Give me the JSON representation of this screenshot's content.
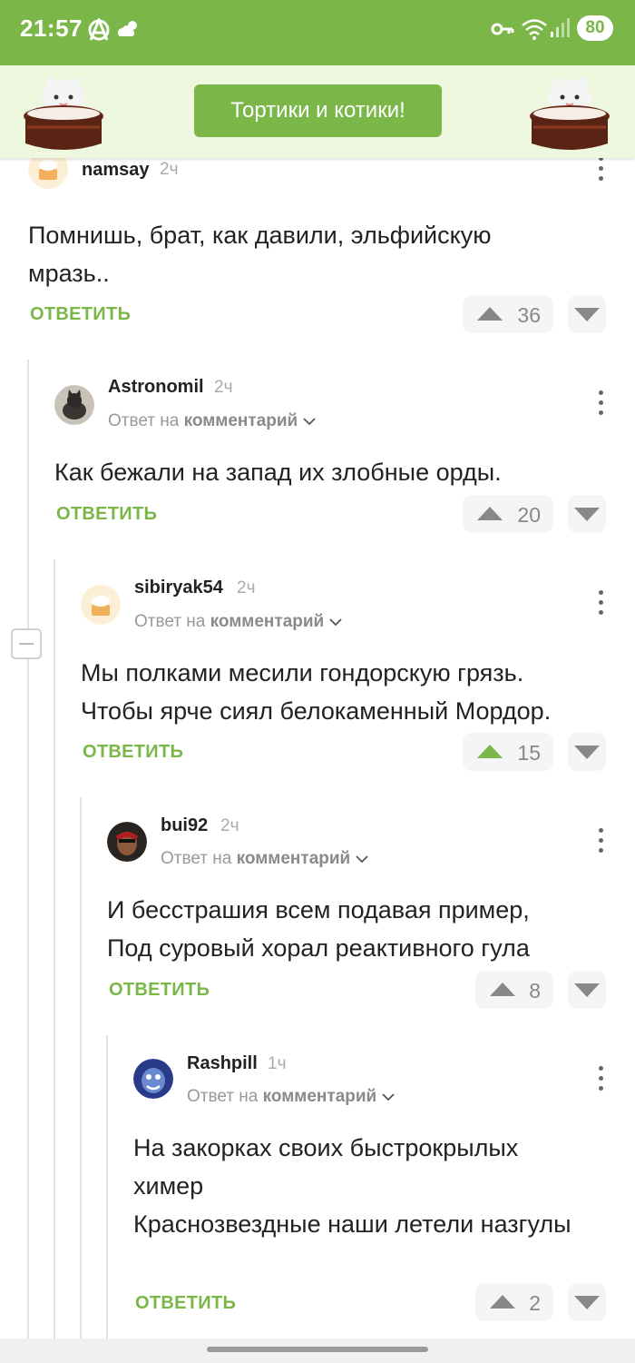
{
  "status_bar": {
    "time": "21:57",
    "battery": "80",
    "icons": [
      "anarchy-icon",
      "weather-icon",
      "key-icon",
      "wifi-icon",
      "signal-icon"
    ]
  },
  "banner": {
    "title": "Тортики и котики!"
  },
  "reply_label": "ОТВЕТИТЬ",
  "comments": [
    {
      "author": "namsay",
      "ago": "2ч",
      "text": "Помнишь, брат, как давили, эльфийскую мразь..",
      "votes": "36"
    },
    {
      "author": "Astronomil",
      "ago": "2ч",
      "reply_prefix": "Ответ на",
      "reply_target": "комментарий",
      "text": "Как бежали на запад их злобные орды.",
      "votes": "20"
    },
    {
      "author": "sibiryak54",
      "ago": "2ч",
      "reply_prefix": "Ответ на",
      "reply_target": "комментарий",
      "text": "Мы полками месили гондорскую грязь.\nЧтобы ярче сиял белокаменный Мордор.",
      "votes": "15"
    },
    {
      "author": "bui92",
      "ago": "2ч",
      "reply_prefix": "Ответ на",
      "reply_target": "комментарий",
      "text": "И бесстрашия всем подавая пример,\nПод суровый хорал реактивного гула",
      "votes": "8"
    },
    {
      "author": "Rashpill",
      "ago": "1ч",
      "reply_prefix": "Ответ на",
      "reply_target": "комментарий",
      "text": "На закорках своих быстрокрылых химер\nКраснозвездные наши летели назгулы",
      "votes": "2"
    }
  ],
  "colors": {
    "accent": "#7ab648",
    "banner_bg": "#eef8de",
    "vote_bg": "#f5f5f5"
  }
}
